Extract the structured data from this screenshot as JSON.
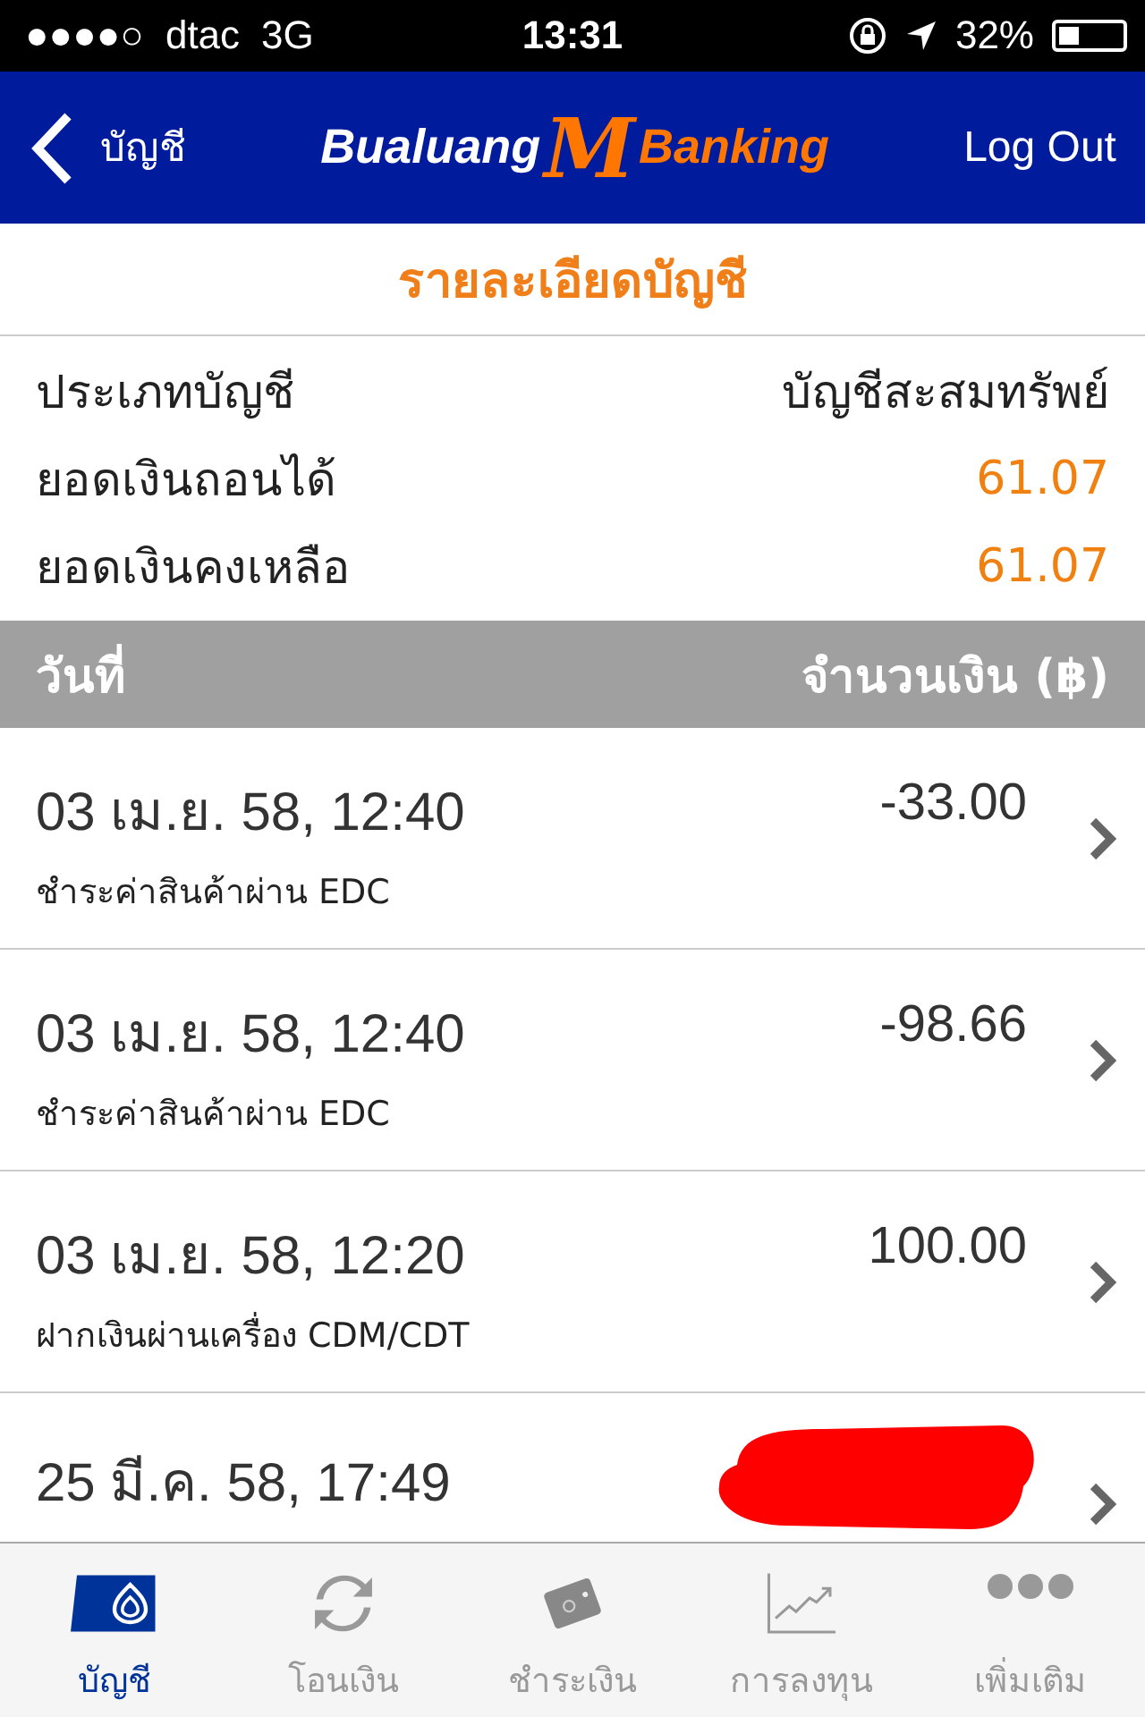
{
  "status_bar": {
    "signal_dots": "●●●●○",
    "carrier": "dtac",
    "network": "3G",
    "time": "13:31",
    "battery": "32%"
  },
  "nav": {
    "back": "บัญชี",
    "logo": [
      "Bualuang",
      "M",
      "Banking"
    ],
    "action": "Log Out"
  },
  "title": "รายละเอียดบัญชี",
  "info": [
    {
      "label": "ประเภทบัญชี",
      "value": "บัญชีสะสมทรัพย์",
      "kind": "text"
    },
    {
      "label": "ยอดเงินถอนได้",
      "value": "61.07",
      "kind": "amount"
    },
    {
      "label": "ยอดเงินคงเหลือ",
      "value": "61.07",
      "kind": "amount"
    }
  ],
  "table": {
    "columns": [
      "วันที่",
      "จำนวนเงิน (฿)"
    ],
    "rows": [
      {
        "date": "03 เม.ย. 58, 12:40",
        "description": "ชำระค่าสินค้าผ่าน EDC",
        "amount": "-33.00"
      },
      {
        "date": "03 เม.ย. 58, 12:40",
        "description": "ชำระค่าสินค้าผ่าน EDC",
        "amount": "-98.66"
      },
      {
        "date": "03 เม.ย. 58, 12:20",
        "description": "ฝากเงินผ่านเครื่อง CDM/CDT",
        "amount": "100.00"
      },
      {
        "date": "25 มี.ค. 58, 17:49"
      }
    ]
  },
  "tab_bar": [
    {
      "label": "บัญชี",
      "kind": "account",
      "selected": true
    },
    {
      "label": "โอนเงิน",
      "kind": "transfer",
      "selected": false
    },
    {
      "label": "ชำระเงิน",
      "kind": "wallet",
      "selected": false
    },
    {
      "label": "การลงทุน",
      "kind": "chart",
      "selected": false
    },
    {
      "label": "เพิ่มเติม",
      "kind": "more",
      "selected": false
    }
  ]
}
